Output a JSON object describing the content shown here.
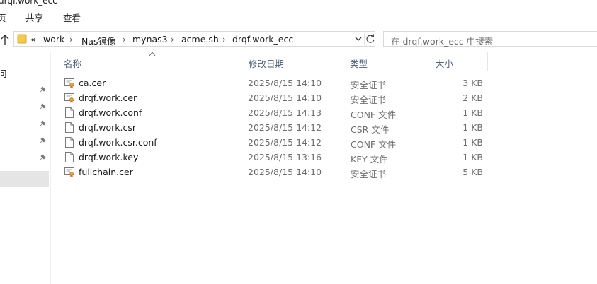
{
  "window": {
    "title": "drqf.work_ecc"
  },
  "ribbon": {
    "tabs": [
      "页",
      "共享",
      "查看"
    ]
  },
  "addressbar": {
    "overflow": "«",
    "crumbs": [
      "work",
      "Nas镜像",
      "mynas3",
      "acme.sh",
      "drqf.work_ecc"
    ],
    "search_placeholder": "在 drqf.work_ecc 中搜索"
  },
  "navpane": {
    "fragment": "问"
  },
  "columns": {
    "name": "名称",
    "date": "修改日期",
    "type": "类型",
    "size": "大小"
  },
  "files": [
    {
      "name": "ca.cer",
      "date": "2025/8/15 14:10",
      "type": "安全证书",
      "size": "3 KB",
      "icon": "certificate-icon"
    },
    {
      "name": "drqf.work.cer",
      "date": "2025/8/15 14:10",
      "type": "安全证书",
      "size": "2 KB",
      "icon": "certificate-icon"
    },
    {
      "name": "drqf.work.conf",
      "date": "2025/8/15 14:13",
      "type": "CONF 文件",
      "size": "1 KB",
      "icon": "file-icon"
    },
    {
      "name": "drqf.work.csr",
      "date": "2025/8/15 14:12",
      "type": "CSR 文件",
      "size": "1 KB",
      "icon": "file-icon"
    },
    {
      "name": "drqf.work.csr.conf",
      "date": "2025/8/15 14:12",
      "type": "CONF 文件",
      "size": "1 KB",
      "icon": "file-icon"
    },
    {
      "name": "drqf.work.key",
      "date": "2025/8/15 13:16",
      "type": "KEY 文件",
      "size": "1 KB",
      "icon": "file-icon"
    },
    {
      "name": "fullchain.cer",
      "date": "2025/8/15 14:10",
      "type": "安全证书",
      "size": "5 KB",
      "icon": "certificate-icon"
    }
  ],
  "colors": {
    "header_text": "#4c607a",
    "secondary_text": "#6d6d6d",
    "folder_yellow": "#f4c94d",
    "selection": "#e5e5e5"
  }
}
